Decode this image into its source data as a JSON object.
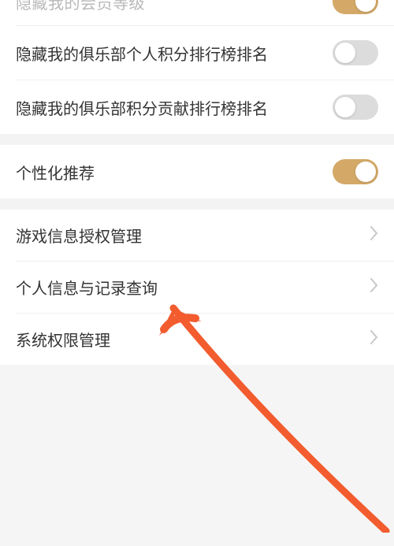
{
  "section1": {
    "item0": {
      "label": "隐藏我的会员等级",
      "on": true
    },
    "item1": {
      "label": "隐藏我的俱乐部个人积分排行榜排名",
      "on": false
    },
    "item2": {
      "label": "隐藏我的俱乐部积分贡献排行榜排名",
      "on": false
    }
  },
  "section2": {
    "item0": {
      "label": "个性化推荐",
      "on": true
    }
  },
  "section3": {
    "item0": {
      "label": "游戏信息授权管理"
    },
    "item1": {
      "label": "个人信息与记录查询"
    },
    "item2": {
      "label": "系统权限管理"
    }
  },
  "colors": {
    "accent": "#d4a968",
    "annotation": "#ff5722"
  }
}
